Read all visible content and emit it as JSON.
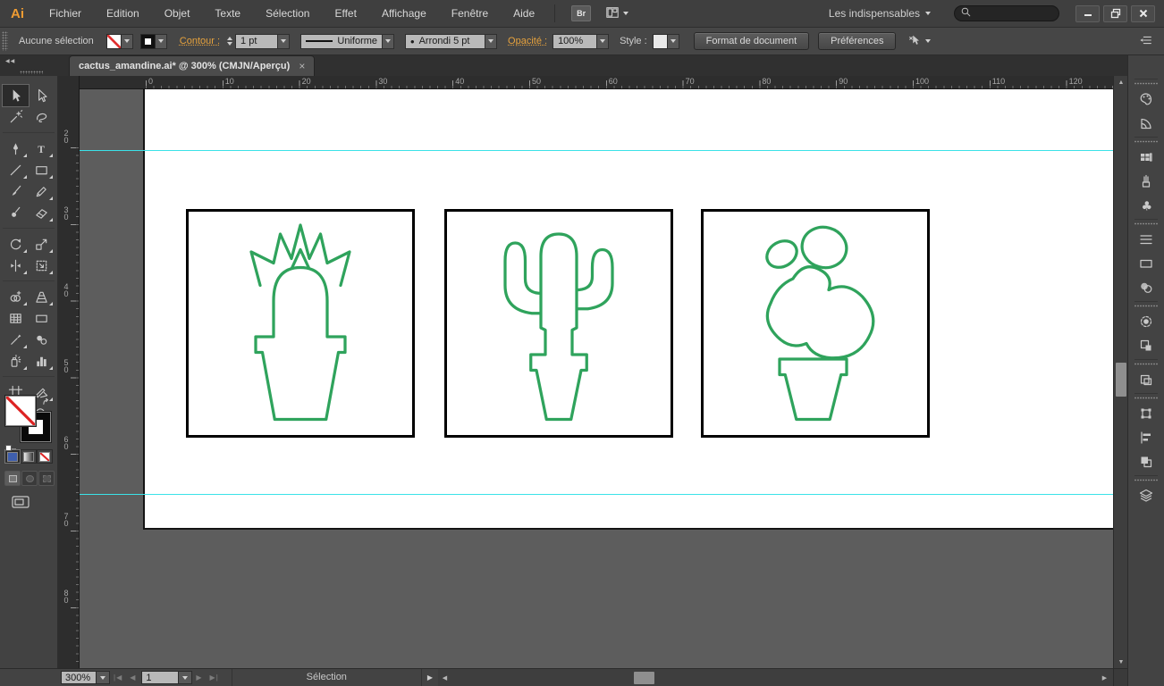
{
  "app": {
    "logo": "Ai"
  },
  "menu": {
    "items": [
      "Fichier",
      "Edition",
      "Objet",
      "Texte",
      "Sélection",
      "Effet",
      "Affichage",
      "Fenêtre",
      "Aide"
    ]
  },
  "appbar": {
    "bridge_label": "Br",
    "workspace_label": "Les indispensables",
    "search_value": ""
  },
  "control_bar": {
    "selection_status": "Aucune sélection",
    "contour_label": "Contour :",
    "stroke_weight": "1 pt",
    "variable_width_profile": "Uniforme",
    "brush_definition": "Arrondi 5 pt",
    "opacity_label": "Opacité :",
    "opacity_value": "100%",
    "style_label": "Style :",
    "document_setup_button": "Format de document",
    "preferences_button": "Préférences"
  },
  "document": {
    "tab_title": "cactus_amandine.ai* @ 300% (CMJN/Aperçu)",
    "tab_close": "×"
  },
  "rulers": {
    "horizontal_labels": [
      "0",
      "10",
      "20",
      "30",
      "40",
      "50",
      "60",
      "70",
      "80",
      "90",
      "100",
      "110",
      "120"
    ],
    "vertical_labels": [
      "20",
      "30",
      "40",
      "50",
      "60",
      "70",
      "80"
    ]
  },
  "toolbar_tools": [
    "selection",
    "direct-selection",
    "magic-wand",
    "lasso",
    "pen",
    "type",
    "line-segment",
    "rectangle",
    "paintbrush",
    "pencil",
    "blob-brush",
    "eraser",
    "rotate",
    "scale",
    "width",
    "free-transform",
    "shape-builder",
    "perspective-grid",
    "mesh",
    "gradient",
    "eyedropper",
    "blend",
    "symbol-sprayer",
    "column-graph",
    "artboard",
    "slice",
    "hand",
    "zoom"
  ],
  "dock_panels": [
    "color",
    "color-guide",
    "swatches",
    "brushes",
    "symbols",
    "stroke",
    "gradient",
    "transparency",
    "appearance",
    "graphic-styles",
    "artboards",
    "transform",
    "align",
    "pathfinder",
    "layers"
  ],
  "status_bar": {
    "zoom_level": "300%",
    "first_page": "|◀",
    "prev_page": "◀",
    "artboard_number": "1",
    "next_page": "▶",
    "last_page": "▶|",
    "status_text": "Sélection",
    "expand_arrow": "▶"
  },
  "icons": {
    "collapse_double_arrow": "◀◀",
    "dropdown_arrow": "▼",
    "bullet": "•",
    "scroll_up": "▲",
    "scroll_down": "▼",
    "scroll_left": "◀",
    "scroll_right": "▶"
  },
  "colors": {
    "cactus_stroke": "#2fa35c",
    "guide": "#3be2e8",
    "frame_stroke": "#000000",
    "accent_orange": "#e8a33d"
  }
}
